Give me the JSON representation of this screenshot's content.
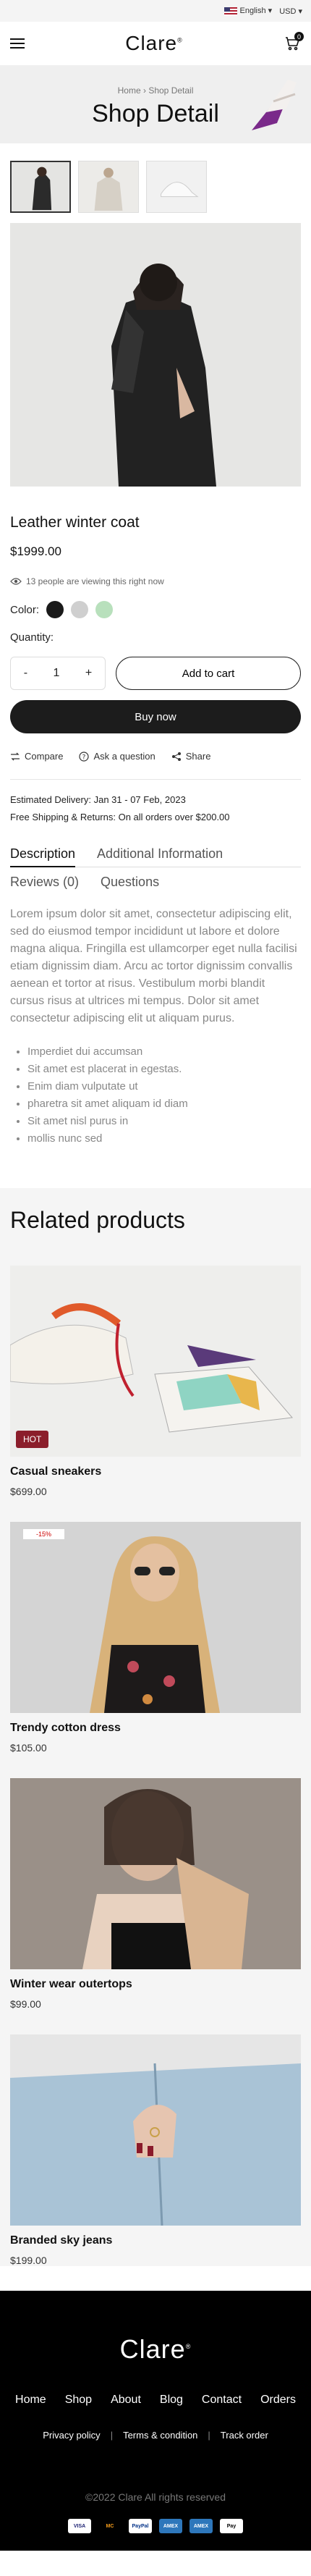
{
  "topbar": {
    "language": "English",
    "currency": "USD"
  },
  "header": {
    "logo": "Clare",
    "logo_mark": "®",
    "cart_count": "0"
  },
  "hero": {
    "breadcrumb_home": "Home",
    "breadcrumb_sep": "›",
    "breadcrumb_current": "Shop Detail",
    "title": "Shop Detail"
  },
  "product": {
    "title": "Leather winter coat",
    "price": "$1999.00",
    "viewing": "13 people are viewing this right now",
    "color_label": "Color:",
    "colors": [
      "#1a1a1a",
      "#cfcfcf",
      "#b8e0bc"
    ],
    "quantity_label": "Quantity:",
    "quantity_minus": "-",
    "quantity": "1",
    "quantity_plus": "+",
    "add_to_cart": "Add to cart",
    "buy_now": "Buy now",
    "compare": "Compare",
    "ask": "Ask a question",
    "share": "Share",
    "delivery_label": "Estimated Delivery:",
    "delivery_value": "Jan 31 - 07 Feb, 2023",
    "shipping_label": "Free Shipping & Returns:",
    "shipping_value": "On all orders over $200.00"
  },
  "tabs": {
    "description": "Description",
    "additional": "Additional Information",
    "reviews": "Reviews (0)",
    "questions": "Questions"
  },
  "description": "Lorem ipsum dolor sit amet, consectetur adipiscing elit, sed do eiusmod tempor incididunt ut labore et dolore magna aliqua. Fringilla est ullamcorper eget nulla facilisi etiam dignissim diam. Arcu ac tortor dignissim convallis aenean et tortor at risus. Vestibulum morbi blandit cursus risus at ultrices mi tempus. Dolor sit amet consectetur adipiscing elit ut aliquam purus.",
  "bullets": [
    "Imperdiet dui accumsan",
    "Sit amet est placerat in egestas.",
    "Enim diam vulputate ut",
    "pharetra sit amet aliquam id diam",
    "Sit amet nisl purus in",
    "mollis nunc sed"
  ],
  "related": {
    "title": "Related products",
    "items": [
      {
        "name": "Casual sneakers",
        "price": "$699.00",
        "badge": "HOT"
      },
      {
        "name": "Trendy  cotton dress",
        "price": "$105.00",
        "badge": "-15%"
      },
      {
        "name": "Winter wear outertops",
        "price": "$99.00"
      },
      {
        "name": "Branded sky jeans",
        "price": "$199.00"
      }
    ]
  },
  "footer": {
    "logo": "Clare",
    "nav": [
      "Home",
      "Shop",
      "About",
      "Blog",
      "Contact",
      "Orders"
    ],
    "links": [
      "Privacy policy",
      "Terms & condition",
      "Track order"
    ],
    "copyright": "©2022 Clare All rights reserved",
    "payments": [
      "VISA",
      "MC",
      "PayPal",
      "AMEX",
      "AMEX",
      "Pay"
    ]
  }
}
